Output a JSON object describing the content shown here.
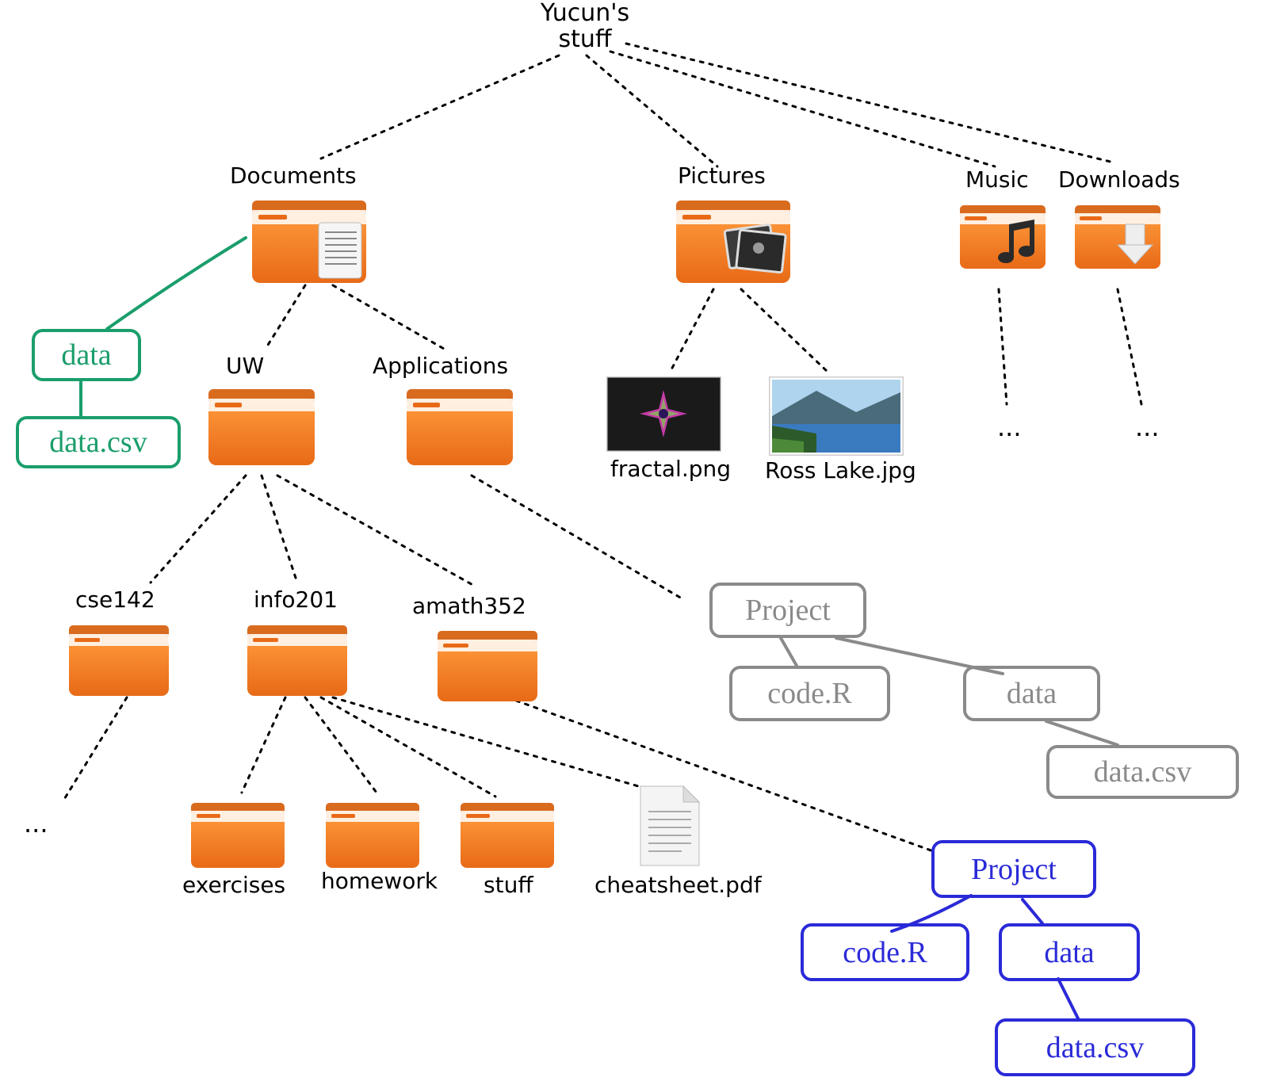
{
  "root": {
    "title": "Yucun's\nstuff"
  },
  "folders": {
    "documents": "Documents",
    "pictures": "Pictures",
    "music": "Music",
    "downloads": "Downloads",
    "uw": "UW",
    "applications": "Applications",
    "cse142": "cse142",
    "info201": "info201",
    "amath352": "amath352",
    "exercises": "exercises",
    "homework": "homework",
    "stuff": "stuff"
  },
  "files": {
    "fractal": "fractal.png",
    "rosslake": "Ross Lake.jpg",
    "cheatsheet": "cheatsheet.pdf"
  },
  "ellipsis": {
    "e1": "...",
    "e2": "...",
    "e3": "..."
  },
  "annotations": {
    "green": {
      "data": "data",
      "datacsv": "data.csv"
    },
    "gray": {
      "project": "Project",
      "code": "code.R",
      "data": "data",
      "datacsv": "data.csv"
    },
    "blue": {
      "project": "Project",
      "code": "code.R",
      "data": "data",
      "datacsv": "data.csv"
    }
  },
  "colors": {
    "green": "#1a9e6b",
    "gray": "#8a8a8a",
    "blue": "#2a2ad8"
  }
}
